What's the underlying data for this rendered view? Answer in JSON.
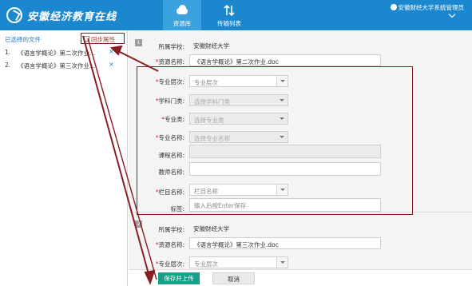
{
  "app": {
    "brand": "安徽经济教育在线",
    "nav": [
      {
        "label": "资源库",
        "icon": "cloud-icon",
        "active": true
      },
      {
        "label": "传输列表",
        "icon": "transfer-icon",
        "active": false
      }
    ],
    "user": "安徽财经大学系统管理员"
  },
  "left_panel": {
    "title": "已选择的文件",
    "sync_label": "同步属性",
    "files": [
      {
        "num": "1.",
        "name": "《语言学概论》第二次作业..."
      },
      {
        "num": "2.",
        "name": "《语言学概论》第三次作业..."
      }
    ],
    "remove_symbol": "×"
  },
  "section1": {
    "badge": "1",
    "school_label": "所属学校:",
    "school_value": "安徽财经大学",
    "resource_label": "资源名称:",
    "resource_value": "《语言学概论》第二次作业.doc",
    "level_label": "专业层次:",
    "level_value": "专业层次",
    "category_label": "学科门类:",
    "category_value": "选择学科门类",
    "major_type_label": "专业类:",
    "major_type_value": "选择专业类",
    "major_name_label": "专业名称:",
    "major_name_value": "选择专业名称",
    "course_label": "课程名称:",
    "course_value": "",
    "teacher_label": "教师名称:",
    "teacher_value": "",
    "column_label": "栏目名称:",
    "column_value": "栏目名称",
    "tags_label": "标签:",
    "tags_placeholder": "输入后按Enter保存"
  },
  "section2": {
    "badge": "2",
    "school_label": "所属学校:",
    "school_value": "安徽财经大学",
    "resource_label": "资源名称:",
    "resource_value": "《语言学概论》第三次作业.doc",
    "level_label": "专业层次:",
    "level_value": "专业层次"
  },
  "footer": {
    "save_label": "保存并上传",
    "cancel_label": "取消"
  },
  "required_mark": "*",
  "colors": {
    "header": "#1a87cf",
    "annotation": "#8a1d22",
    "primary_button": "#16a087",
    "required": "#d32f2f"
  }
}
